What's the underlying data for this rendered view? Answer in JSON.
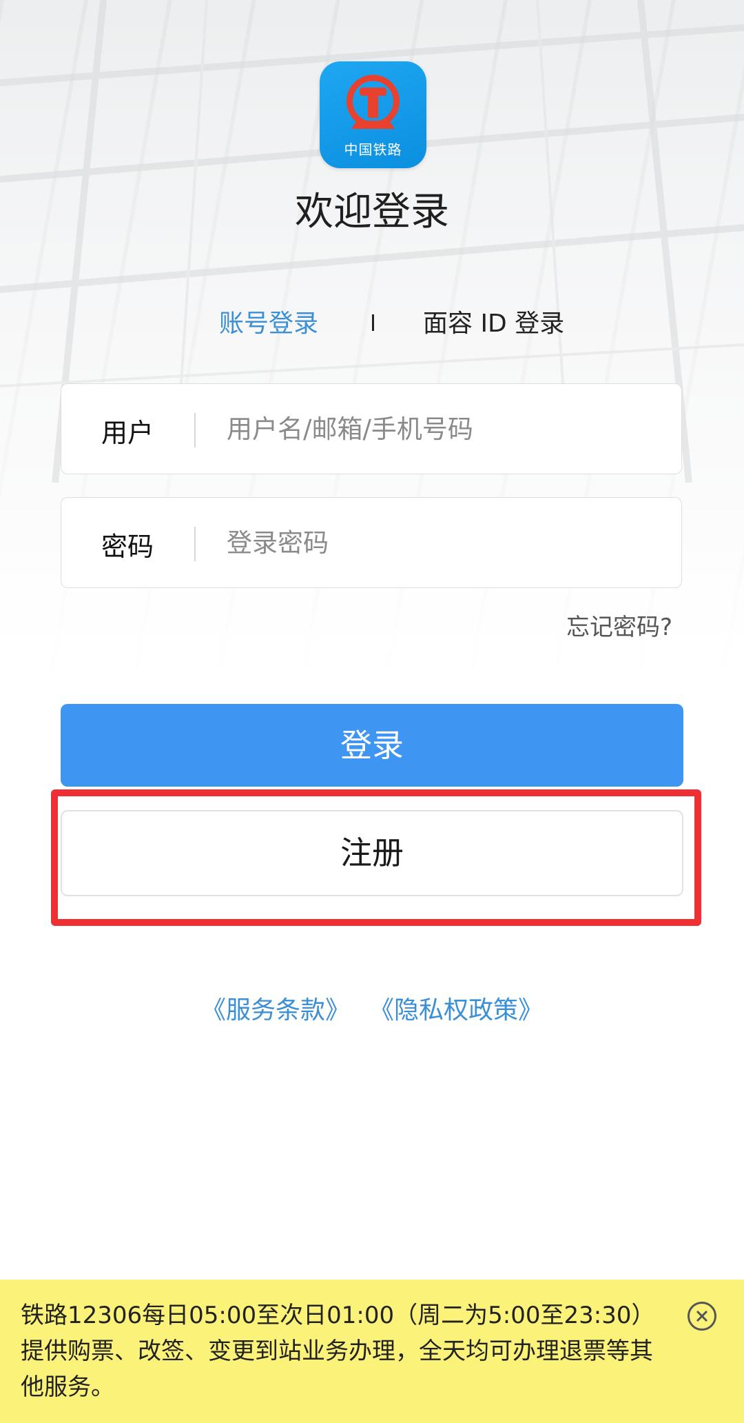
{
  "app": {
    "logo_text": "中国铁路",
    "brand_color": "#0b8fe0",
    "logo_red": "#e8412d"
  },
  "page": {
    "title": "欢迎登录"
  },
  "tabs": {
    "account_login": "账号登录",
    "face_id_login": "面容 ID 登录",
    "active": "account_login",
    "active_color": "#3b8fd6"
  },
  "form": {
    "user_label": "用户",
    "user_placeholder": "用户名/邮箱/手机号码",
    "user_value": "",
    "password_label": "密码",
    "password_placeholder": "登录密码",
    "password_value": "",
    "forgot_password": "忘记密码?"
  },
  "buttons": {
    "login": "登录",
    "login_color": "#3e95f2",
    "register": "注册",
    "highlight_color": "#ee2f34"
  },
  "links": {
    "terms": "《服务条款》",
    "privacy": "《隐私权政策》"
  },
  "notice": {
    "text": "铁路12306每日05:00至次日01:00（周二为5:00至23:30）提供购票、改签、变更到站业务办理，全天均可办理退票等其他服务。",
    "background": "#fbf27a",
    "close_icon": "close-circle-icon"
  }
}
